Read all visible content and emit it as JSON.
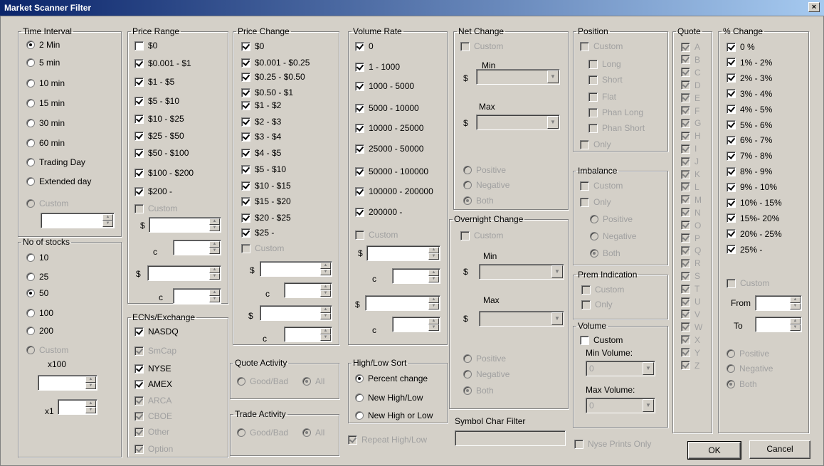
{
  "window": {
    "title": "Market Scanner Filter",
    "close": "×"
  },
  "time_interval": {
    "legend": "Time Interval",
    "items": [
      "2 Min",
      "5 min",
      "10 min",
      "15 min",
      "30 min",
      "60 min",
      "Trading Day",
      "Extended day"
    ],
    "custom": "Custom"
  },
  "no_of_stocks": {
    "legend": "No of stocks",
    "items": [
      "10",
      "25",
      "50",
      "100",
      "200"
    ],
    "custom": "Custom",
    "x100": "x100",
    "x1": "x1"
  },
  "price_range": {
    "legend": "Price Range",
    "items": [
      "$0",
      "$0.001 - $1",
      " $1 - $5",
      "$5 - $10",
      "$10 - $25",
      " $25 - $50",
      "$50 - $100",
      "$100 - $200",
      "$200 -"
    ],
    "custom": "Custom",
    "dollar": "$",
    "cent": "c"
  },
  "ecns": {
    "legend": "ECNs/Exchange",
    "items": [
      "NASDQ",
      "SmCap",
      "NYSE",
      "AMEX",
      "ARCA",
      "CBOE",
      "Other",
      "Option"
    ]
  },
  "price_change": {
    "legend": "Price Change",
    "items": [
      "$0",
      "$0.001 - $0.25",
      "$0.25 - $0.50",
      "$0.50 - $1",
      "$1 - $2",
      "$2 - $3",
      "$3 - $4",
      " $4 - $5",
      "$5 - $10",
      "$10 - $15",
      " $15 - $20",
      "$20 - $25",
      "$25 -"
    ],
    "custom": "Custom",
    "dollar": "$",
    "cent": "c"
  },
  "quote_activity": {
    "legend": "Quote Activity",
    "good_bad": "Good/Bad",
    "all": "All"
  },
  "trade_activity": {
    "legend": "Trade Activity",
    "good_bad": "Good/Bad",
    "all": "All"
  },
  "volume_rate": {
    "legend": "Volume Rate",
    "items": [
      "0",
      "1 - 1000",
      "1000 - 5000",
      "5000 - 10000",
      "10000 - 25000",
      "25000 - 50000",
      "50000 - 100000",
      "100000 - 200000",
      "200000 -"
    ],
    "custom": "Custom",
    "dollar": "$",
    "cent": "c"
  },
  "high_low_sort": {
    "legend": "High/Low Sort",
    "items": [
      "Percent change",
      "New High/Low",
      "New High or Low"
    ]
  },
  "repeat_high_low": "Repeat High/Low",
  "net_change": {
    "legend": "Net Change",
    "custom": "Custom",
    "min": "Min",
    "max": "Max",
    "dollar": "$",
    "options": [
      "Positive",
      "Negative",
      "Both"
    ]
  },
  "overnight_change": {
    "legend": "Overnight Change",
    "custom": "Custom",
    "min": "Min",
    "max": "Max",
    "dollar": "$",
    "options": [
      "Positive",
      "Negative",
      "Both"
    ]
  },
  "symbol_char_filter": "Symbol Char Filter",
  "position": {
    "legend": "Position",
    "custom": "Custom",
    "items": [
      "Long",
      "Short",
      "Flat",
      "Phan Long",
      "Phan Short"
    ],
    "only": "Only"
  },
  "imbalance": {
    "legend": "Imbalance",
    "custom": "Custom",
    "only": "Only",
    "options": [
      "Positive",
      "Negative",
      "Both"
    ]
  },
  "prem_indication": {
    "legend": "Prem Indication",
    "custom": "Custom",
    "only": "Only"
  },
  "volume": {
    "legend": "Volume",
    "custom": "Custom",
    "min_label": "Min Volume:",
    "max_label": "Max Volume:",
    "min_value": "0",
    "max_value": "0"
  },
  "nyse_prints_only": "Nyse Prints Only",
  "quote": {
    "legend": "Quote",
    "letters": [
      "A",
      "B",
      "C",
      "D",
      "E",
      "F",
      "G",
      "H",
      "I",
      "J",
      "K",
      "L",
      "M",
      "N",
      "O",
      "P",
      "Q",
      "R",
      "S",
      "T",
      "U",
      "V",
      "W",
      "X",
      "Y",
      "Z"
    ]
  },
  "pct_change": {
    "legend": "% Change",
    "items": [
      "0 %",
      "1% - 2%",
      "2% - 3%",
      "3% - 4%",
      "4% - 5%",
      "5% - 6%",
      "6% - 7%",
      "7% - 8%",
      "8% - 9%",
      "9% - 10%",
      "10% - 15%",
      "15%- 20%",
      "20% - 25%",
      "25% -"
    ],
    "custom": "Custom",
    "from": "From",
    "to": "To",
    "options": [
      "Positive",
      "Negative",
      "Both"
    ]
  },
  "buttons": {
    "ok": "OK",
    "cancel": "Cancel"
  }
}
